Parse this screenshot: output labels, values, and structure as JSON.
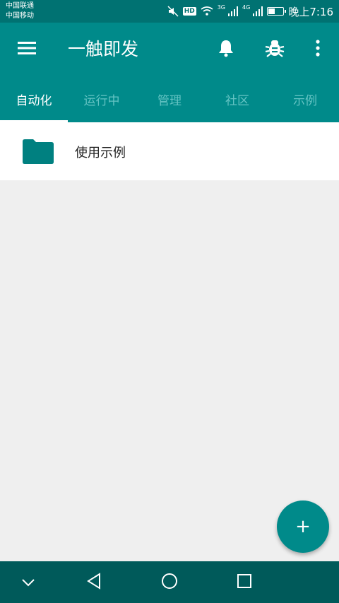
{
  "status_bar": {
    "carrier1": "中国联通",
    "carrier2": "中国移动",
    "network1": "3G",
    "network2": "4G",
    "hd_label": "HD",
    "battery_level": 0.45,
    "time": "晚上7:16"
  },
  "app_bar": {
    "title": "一触即发",
    "menu_icon": "hamburger-menu-icon",
    "notification_icon": "bell-icon",
    "debug_icon": "bug-icon",
    "more_icon": "more-vert-icon"
  },
  "tabs": [
    {
      "label": "自动化",
      "active": true
    },
    {
      "label": "运行中",
      "active": false
    },
    {
      "label": "管理",
      "active": false
    },
    {
      "label": "社区",
      "active": false
    },
    {
      "label": "示例",
      "active": false
    }
  ],
  "list": {
    "items": [
      {
        "label": "使用示例",
        "icon": "folder-icon"
      }
    ]
  },
  "fab": {
    "label": "+"
  },
  "colors": {
    "primary": "#008a8a",
    "status_bar": "#007272",
    "nav_bar": "#005a5a",
    "inactive_tab": "#64c3c3",
    "background": "#efefef"
  }
}
